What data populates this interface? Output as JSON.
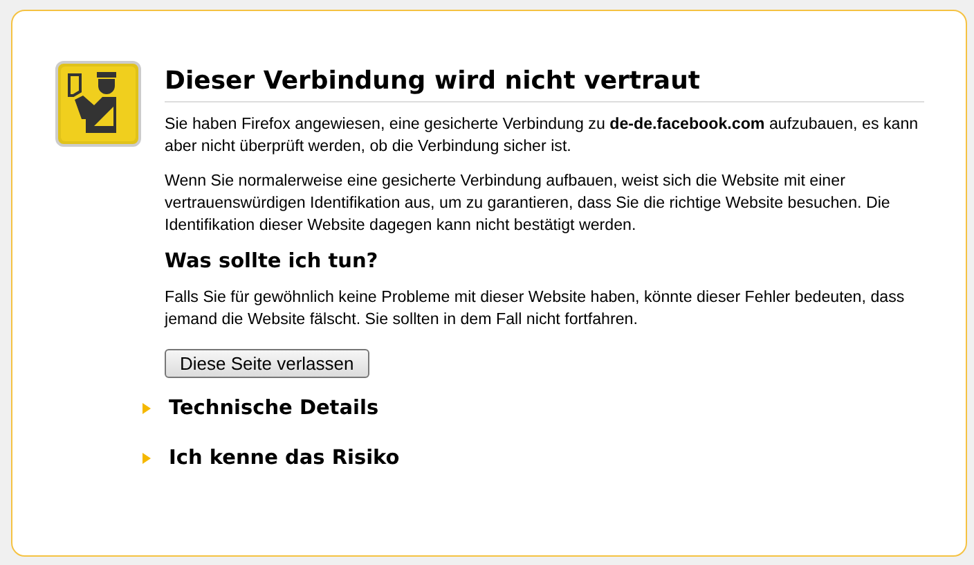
{
  "title": "Dieser Verbindung wird nicht vertraut",
  "intro": "Sie haben Firefox angewiesen, eine gesicherte Verbindung zu **de-de.facebook.com** aufzubauen, es kann aber nicht überprüft werden, ob die Verbindung sicher ist.",
  "explanation": "Wenn Sie normalerweise eine gesicherte Verbindung aufbauen, weist sich die Website mit einer vertrauenswürdigen Identifikation aus, um zu garantieren, dass Sie die richtige Website besuchen. Die Identifikation dieser Website dagegen kann nicht bestätigt werden.",
  "what_to_do": {
    "heading": "Was sollte ich tun?",
    "text": "Falls Sie für gewöhnlich keine Probleme mit dieser Website haben, könnte dieser Fehler bedeuten, dass jemand die Website fälscht. Sie sollten in dem Fall nicht fortfahren.",
    "button": "Diese Seite verlassen"
  },
  "sections": [
    {
      "label": "Technische Details",
      "expanded": false
    },
    {
      "label": "Ich kenne das Risiko",
      "expanded": false
    }
  ]
}
